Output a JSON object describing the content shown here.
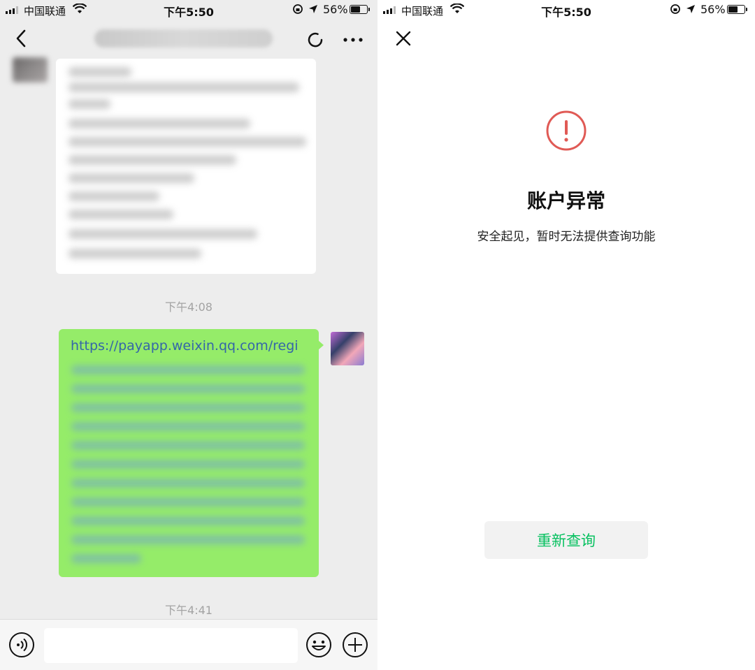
{
  "left": {
    "status_bar": {
      "carrier": "中国联通",
      "time": "下午5:50",
      "battery": "56%"
    },
    "chat": {
      "time_first": "下午4:08",
      "link_text": "https://payapp.weixin.qq.com/regi",
      "time_second": "下午4:41"
    },
    "icons": {
      "back": "chevron-left-icon",
      "refresh": "refresh-icon",
      "more": "more-icon",
      "voice": "voice-icon",
      "emoji": "emoji-icon",
      "plus": "plus-icon"
    }
  },
  "right": {
    "status_bar": {
      "carrier": "中国联通",
      "time": "下午5:50",
      "battery": "56%"
    },
    "title": "账户异常",
    "description": "安全起见，暂时无法提供查询功能",
    "retry_button": "重新查询",
    "icons": {
      "close": "close-icon",
      "warning": "warning-circle-icon"
    },
    "colors": {
      "warning": "#e05a55",
      "button_text": "#07c160",
      "outgoing_bubble": "#95ec69"
    }
  }
}
